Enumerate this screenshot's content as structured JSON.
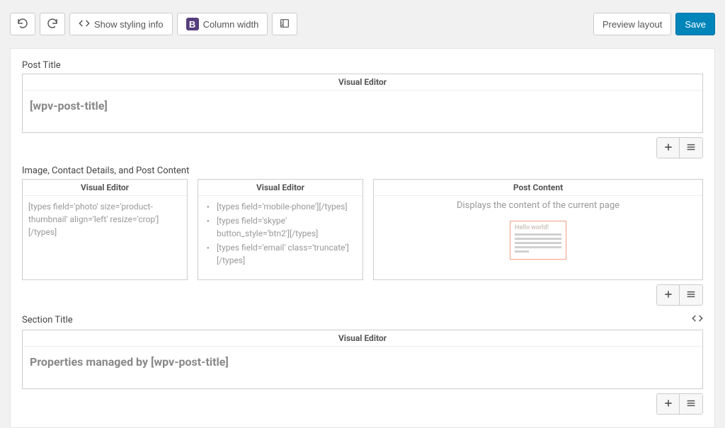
{
  "toolbar": {
    "show_styling_label": "Show styling info",
    "column_width_label": "Column width",
    "preview_label": "Preview layout",
    "save_label": "Save"
  },
  "sections": [
    {
      "title": "Post Title",
      "editor_header": "Visual Editor",
      "content": "[wpv-post-title]"
    },
    {
      "title": "Image, Contact Details, and Post Content",
      "columns": [
        {
          "header": "Visual Editor",
          "shortcode": "[types field='photo' size='product-thumbnail' align='left' resize='crop'][/types]"
        },
        {
          "header": "Visual Editor",
          "items": [
            "[types field='mobile-phone'][/types]",
            "[types field='skype' button_style='btn2'][/types]",
            "[types field='email' class='truncate'][/types]"
          ]
        },
        {
          "header": "Post Content",
          "description": "Displays the content of the current page",
          "preview_text": "Hello world!"
        }
      ]
    },
    {
      "title": "Section Title",
      "editor_header": "Visual Editor",
      "content": "Properties managed by [wpv-post-title]"
    }
  ]
}
